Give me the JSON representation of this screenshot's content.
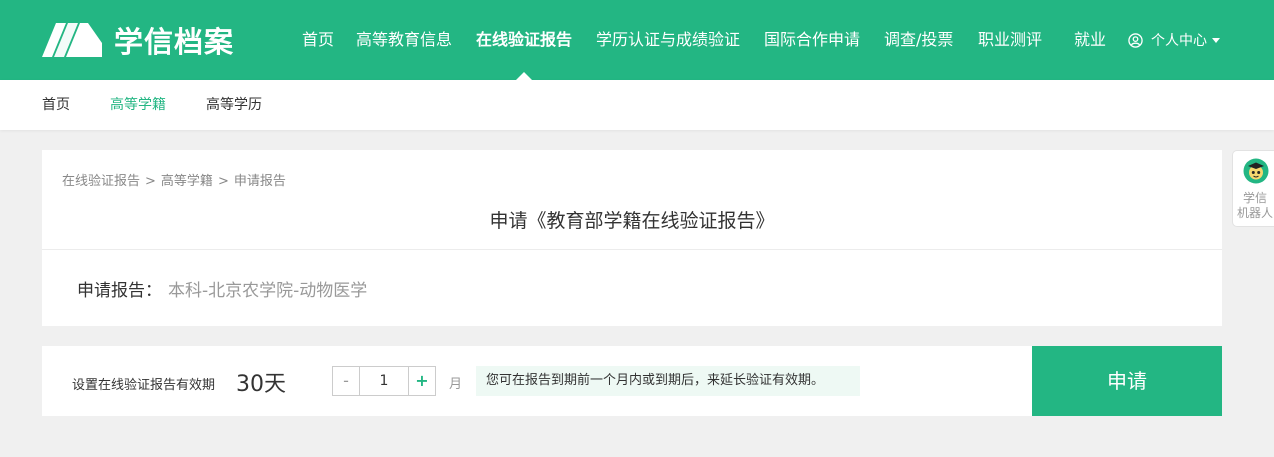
{
  "brand": {
    "name": "学信档案"
  },
  "nav": {
    "items": [
      {
        "label": "首页",
        "active": false
      },
      {
        "label": "高等教育信息",
        "active": false
      },
      {
        "label": "在线验证报告",
        "active": true
      },
      {
        "label": "学历认证与成绩验证",
        "active": false
      },
      {
        "label": "国际合作申请",
        "active": false
      },
      {
        "label": "调查/投票",
        "active": false
      },
      {
        "label": "职业测评",
        "active": false
      },
      {
        "label": "就业",
        "active": false
      }
    ],
    "user_center": "个人中心"
  },
  "subnav": {
    "items": [
      {
        "label": "首页",
        "active": false
      },
      {
        "label": "高等学籍",
        "active": true
      },
      {
        "label": "高等学历",
        "active": false
      }
    ]
  },
  "breadcrumb": {
    "items": [
      "在线验证报告",
      "高等学籍",
      "申请报告"
    ],
    "separator": ">"
  },
  "page": {
    "title": "申请《教育部学籍在线验证报告》",
    "report_label": "申请报告：",
    "report_value": "本科-北京农学院-动物医学"
  },
  "validity": {
    "label": "设置在线验证报告有效期",
    "value": "30天",
    "minus": "-",
    "plus": "+",
    "months": "1",
    "unit": "月",
    "hint": "您可在报告到期前一个月内或到期后，来延长验证有效期。"
  },
  "apply_button": "申请",
  "robot": {
    "line1": "学信",
    "line2": "机器人"
  },
  "colors": {
    "brand_green": "#23b683",
    "hint_bg": "#eef9f4"
  }
}
